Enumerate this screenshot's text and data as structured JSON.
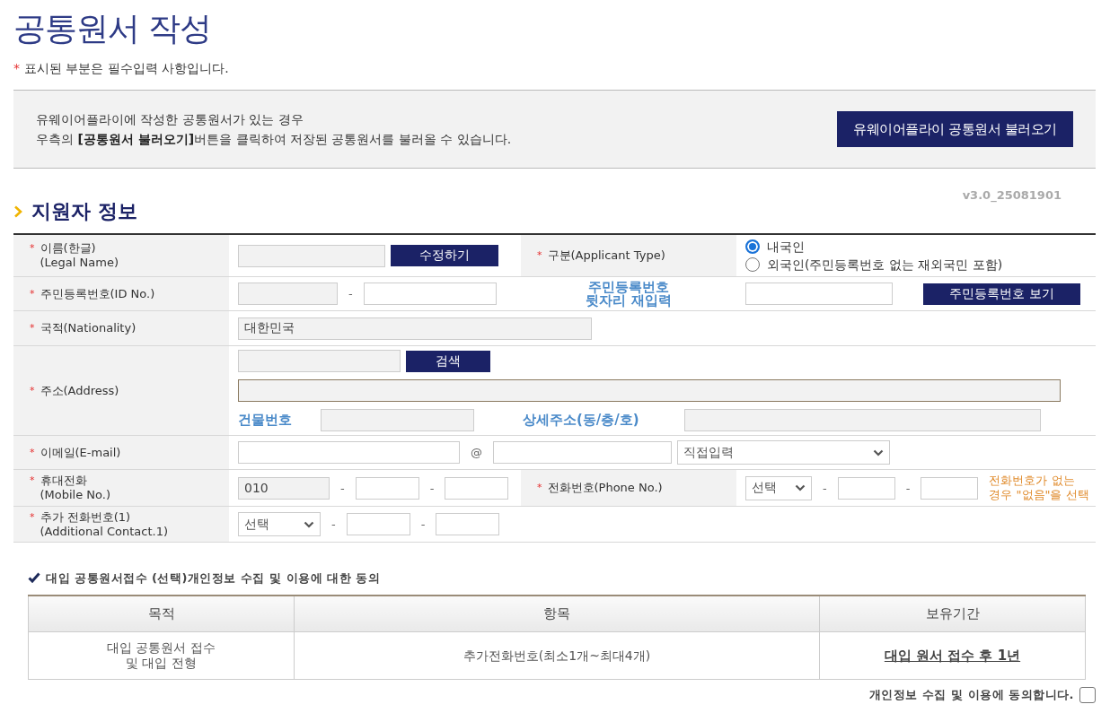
{
  "page_title": "공통원서 작성",
  "required_note": {
    "mark": "*",
    "text": "표시된 부분은 필수입력 사항입니다."
  },
  "import_box": {
    "lines": [
      "유웨이어플라이에 작성한 공통원서가 있는 경우",
      "우측의 **[공통원서 불러오기]**버튼을 클릭하여 저장된 공통원서를 불러올 수 있습니다."
    ],
    "button": "유웨이어플라이 공통원서 불러오기"
  },
  "section": {
    "title": "지원자 정보",
    "version": "v3.0_25081901"
  },
  "form": {
    "rows": [
      {
        "cells": [
          {
            "kind": "label",
            "mark": "*",
            "lines": [
              "이름(한글)",
              "(Legal Name)"
            ]
          },
          {
            "kind": "controls",
            "lines": [
              [
                {
                  "kind": "field",
                  "disabled": true
                },
                {
                  "kind": "button",
                  "label": "수정하기"
                }
              ]
            ]
          },
          {
            "kind": "label",
            "mark": "*",
            "lines": [
              "구분(Applicant Type)"
            ]
          },
          {
            "kind": "controls",
            "lines": [
              [
                {
                  "kind": "radio",
                  "options": [
                    {
                      "label": "내국인",
                      "selected": true
                    },
                    {
                      "label": "외국인(주민등록번호 없는 재외국민 포함)",
                      "selected": false
                    }
                  ]
                }
              ]
            ]
          }
        ]
      },
      {
        "cells": [
          {
            "kind": "label",
            "mark": "*",
            "lines": [
              "주민등록번호(ID No.)"
            ]
          },
          {
            "kind": "controls",
            "lines": [
              [
                {
                  "kind": "field",
                  "disabled": true
                },
                {
                  "kind": "text",
                  "text": "-"
                },
                {
                  "kind": "field",
                  "disabled": false
                }
              ]
            ]
          },
          {
            "kind": "hint",
            "lines": [
              "주민등록번호",
              "뒷자리 재입력"
            ]
          },
          {
            "kind": "controls",
            "lines": [
              [
                {
                  "kind": "field",
                  "disabled": false
                },
                {
                  "kind": "button",
                  "label": "주민등록번호 보기"
                }
              ]
            ]
          }
        ]
      },
      {
        "cells": [
          {
            "kind": "label",
            "mark": "*",
            "lines": [
              "국적(Nationality)"
            ]
          },
          {
            "kind": "controls",
            "colspan": 3,
            "lines": [
              [
                {
                  "kind": "field",
                  "disabled": true,
                  "value": "대한민국"
                }
              ]
            ]
          }
        ]
      },
      {
        "cells": [
          {
            "kind": "label",
            "mark": "*",
            "lines": [
              "주소(Address)"
            ]
          },
          {
            "kind": "controls",
            "colspan": 3,
            "lines": [
              [
                {
                  "kind": "field",
                  "disabled": true
                },
                {
                  "kind": "button",
                  "label": "검색"
                }
              ],
              [
                {
                  "kind": "field",
                  "disabled": true,
                  "focused": true
                }
              ],
              [
                {
                  "kind": "caption",
                  "text": "건물번호"
                },
                {
                  "kind": "field",
                  "disabled": true
                },
                {
                  "kind": "caption",
                  "text": "상세주소(동/층/호)"
                },
                {
                  "kind": "field",
                  "disabled": true
                }
              ]
            ]
          }
        ]
      },
      {
        "cells": [
          {
            "kind": "label",
            "mark": "*",
            "lines": [
              "이메일(E-mail)"
            ]
          },
          {
            "kind": "controls",
            "colspan": 3,
            "lines": [
              [
                {
                  "kind": "field",
                  "disabled": false
                },
                {
                  "kind": "text",
                  "text": "@"
                },
                {
                  "kind": "field",
                  "disabled": false
                },
                {
                  "kind": "select",
                  "value": "직접입력"
                }
              ]
            ]
          }
        ]
      },
      {
        "cells": [
          {
            "kind": "label",
            "mark": "*",
            "lines": [
              "휴대전화",
              "(Mobile No.)"
            ]
          },
          {
            "kind": "controls",
            "lines": [
              [
                {
                  "kind": "field",
                  "disabled": true,
                  "value": "010"
                },
                {
                  "kind": "text",
                  "text": "-"
                },
                {
                  "kind": "field",
                  "disabled": false
                },
                {
                  "kind": "text",
                  "text": "-"
                },
                {
                  "kind": "field",
                  "disabled": false
                }
              ]
            ]
          },
          {
            "kind": "label",
            "mark": "*",
            "lines": [
              "전화번호(Phone No.)"
            ]
          },
          {
            "kind": "controls",
            "lines": [
              [
                {
                  "kind": "select",
                  "value": "선택"
                },
                {
                  "kind": "text",
                  "text": "-"
                },
                {
                  "kind": "field",
                  "disabled": false
                },
                {
                  "kind": "text",
                  "text": "-"
                },
                {
                  "kind": "field",
                  "disabled": false
                },
                {
                  "kind": "note",
                  "lines": [
                    "전화번호가 없는",
                    "경우 \"없음\"을 선택"
                  ]
                }
              ]
            ]
          }
        ]
      },
      {
        "cells": [
          {
            "kind": "label",
            "mark": "*",
            "lines": [
              "추가 전화번호(1)",
              "(Additional Contact.1)"
            ]
          },
          {
            "kind": "controls",
            "colspan": 3,
            "lines": [
              [
                {
                  "kind": "select",
                  "value": "선택"
                },
                {
                  "kind": "text",
                  "text": "-"
                },
                {
                  "kind": "field",
                  "disabled": false
                },
                {
                  "kind": "text",
                  "text": "-"
                },
                {
                  "kind": "field",
                  "disabled": false
                }
              ]
            ]
          }
        ]
      }
    ]
  },
  "consent": {
    "title": "대입 공통원서접수 (선택)개인정보 수집 및 이용에 대한 동의",
    "columns": [
      "목적",
      "항목",
      "보유기간"
    ],
    "rows": [
      [
        {
          "kind": "text",
          "lines": [
            "대입 공통원서 접수",
            "및 대입 전형"
          ]
        },
        {
          "kind": "text",
          "lines": [
            "추가전화번호(최소1개~최대4개)"
          ]
        },
        {
          "kind": "link",
          "lines": [
            "대입 원서 접수 후 1년"
          ]
        }
      ]
    ],
    "agree": {
      "label": "개인정보 수집 및 이용에 동의합니다.",
      "checked": false
    }
  }
}
